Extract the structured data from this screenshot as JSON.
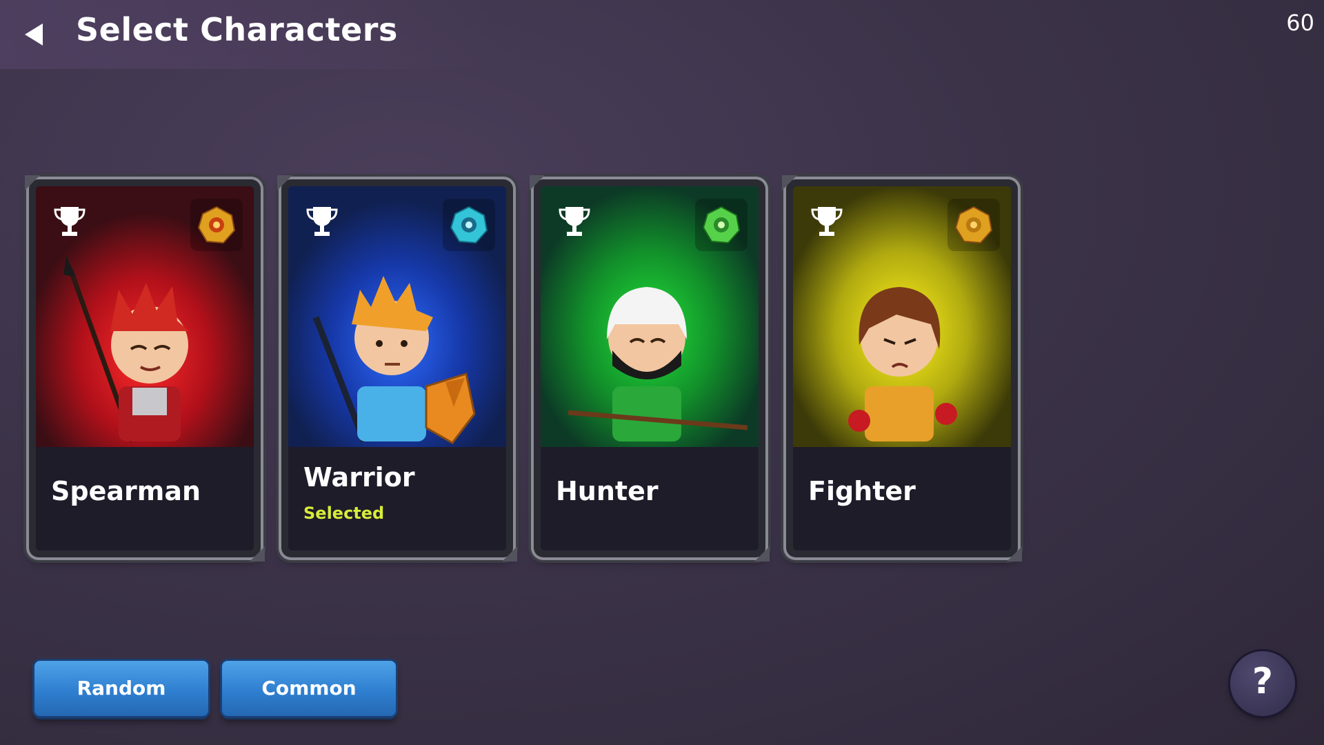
{
  "header": {
    "title": "Select Characters",
    "fps": "60",
    "back_icon": "back-arrow-icon"
  },
  "characters": [
    {
      "name": "Spearman",
      "status": "",
      "theme": "#c4141c",
      "bg": "#3a0e14",
      "gem_color": "#e0a020",
      "gem_icon": "gold-gem-icon"
    },
    {
      "name": "Warrior",
      "status": "Selected",
      "theme": "#1a4fd8",
      "bg": "#102050",
      "gem_color": "#33c4d8",
      "gem_icon": "cyan-gem-icon"
    },
    {
      "name": "Hunter",
      "status": "",
      "theme": "#18b62a",
      "bg": "#0c3a26",
      "gem_color": "#55d24a",
      "gem_icon": "green-gem-icon"
    },
    {
      "name": "Fighter",
      "status": "",
      "theme": "#d8d414",
      "bg": "#3c3a08",
      "gem_color": "#e0a020",
      "gem_icon": "gold-gem-icon"
    }
  ],
  "buttons": {
    "random_label": "Random",
    "common_label": "Common",
    "help_label": "?"
  },
  "colors": {
    "background": "#3c3349",
    "selected_text": "#d7ec3a",
    "button_blue": "#2f7fd0"
  }
}
